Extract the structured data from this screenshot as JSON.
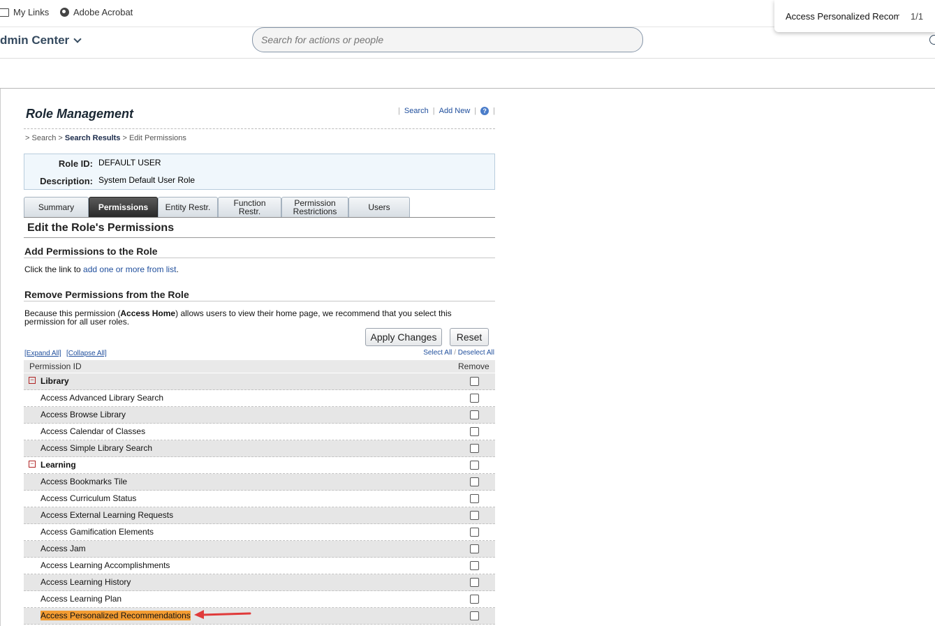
{
  "bookmarks": {
    "items": [
      {
        "label": "My Links",
        "icon": "folder-icon"
      },
      {
        "label": "Adobe Acrobat",
        "icon": "globe-icon"
      }
    ]
  },
  "find_bar": {
    "query": "Access Personalized Recommendations",
    "count": "1/1"
  },
  "header": {
    "app_title": "dmin Center",
    "search_placeholder": "Search for actions or people"
  },
  "role_management": {
    "title": "Role Management",
    "links": {
      "search": "Search",
      "add_new": "Add New"
    },
    "breadcrumb": {
      "sep": ">",
      "search": "Search",
      "results": "Search Results",
      "current": "Edit Permissions"
    },
    "role_id_label": "Role ID:",
    "role_id": "DEFAULT USER",
    "description_label": "Description:",
    "description": "System Default User Role",
    "tabs": [
      {
        "label": "Summary",
        "active": false
      },
      {
        "label": "Permissions",
        "active": true
      },
      {
        "label": "Entity Restr.",
        "active": false
      },
      {
        "label": "Function\nRestr.",
        "active": false
      },
      {
        "label": "Permission\nRestrictions",
        "active": false
      },
      {
        "label": "Users",
        "active": false
      }
    ],
    "edit_heading": "Edit the Role's Permissions",
    "add_heading": "Add Permissions to the Role",
    "add_text_prefix": "Click the link to",
    "add_link": "add one or more from list",
    "remove_heading": "Remove Permissions from the Role",
    "remove_note_prefix": "Because this permission (",
    "remove_note_bold": "Access Home",
    "remove_note_suffix": ") allows users to view their home page, we recommend that you select this permission for all user roles.",
    "apply_button": "Apply Changes",
    "reset_button": "Reset",
    "expand_all": "[Expand All]",
    "collapse_all": "[Collapse All]",
    "select_all": "Select All",
    "deselect_all": "Deselect All",
    "table_headers": {
      "permission": "Permission ID",
      "remove": "Remove"
    },
    "rows": [
      {
        "label": "Library",
        "group": true
      },
      {
        "label": "Access Advanced Library Search",
        "group": false
      },
      {
        "label": "Access Browse Library",
        "group": false
      },
      {
        "label": "Access Calendar of Classes",
        "group": false
      },
      {
        "label": "Access Simple Library Search",
        "group": false
      },
      {
        "label": "Learning",
        "group": true
      },
      {
        "label": "Access Bookmarks Tile",
        "group": false
      },
      {
        "label": "Access Curriculum Status",
        "group": false
      },
      {
        "label": "Access External Learning Requests",
        "group": false
      },
      {
        "label": "Access Gamification Elements",
        "group": false
      },
      {
        "label": "Access Jam",
        "group": false
      },
      {
        "label": "Access Learning Accomplishments",
        "group": false
      },
      {
        "label": "Access Learning History",
        "group": false
      },
      {
        "label": "Access Learning Plan",
        "group": false
      },
      {
        "label": "Access Personalized Recommendations",
        "group": false,
        "highlighted": true
      }
    ]
  },
  "colors": {
    "highlight": "#f39c32",
    "arrow": "#e03b3b",
    "active_tab": "#2a2a2a",
    "link": "#1f4e9c"
  }
}
